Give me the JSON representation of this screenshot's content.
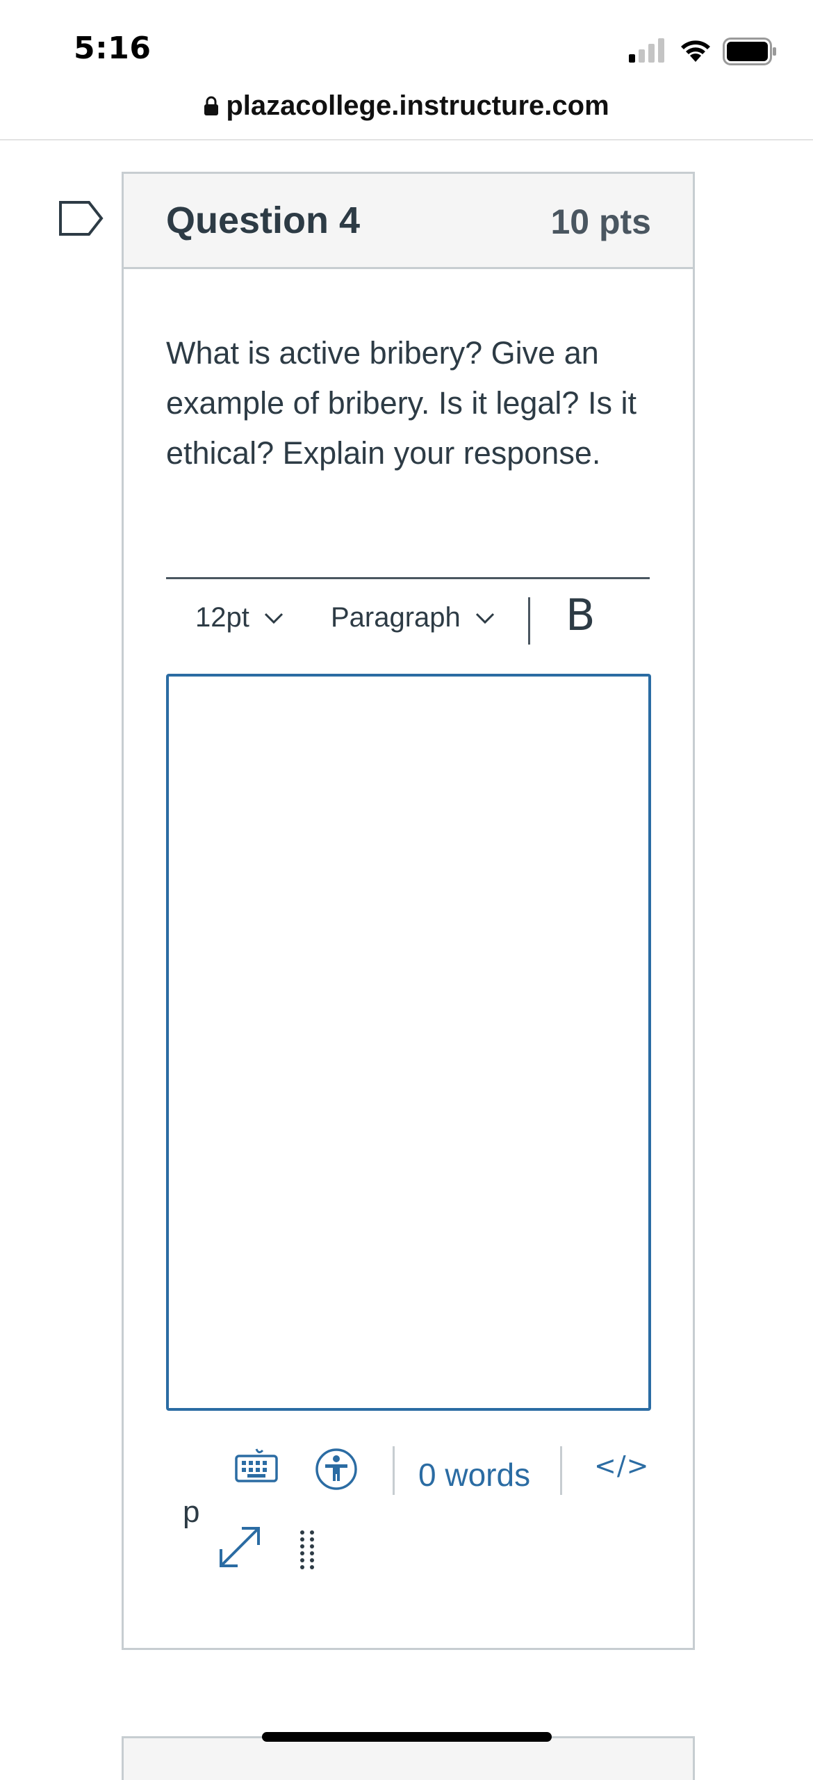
{
  "status_bar": {
    "time": "5:16"
  },
  "browser": {
    "url": "plazacollege.instructure.com"
  },
  "question": {
    "title": "Question 4",
    "points": "10 pts",
    "text": "What is active bribery? Give an example of bribery. Is it legal? Is it ethical? Explain your response."
  },
  "editor": {
    "font_size": "12pt",
    "block_format": "Paragraph",
    "bold_label": "B",
    "content": "",
    "path": "p",
    "word_count": "0 words",
    "html_toggle_label": "</>"
  },
  "colors": {
    "accent": "#2b6ca3",
    "text": "#2d3b45",
    "border": "#c7cdd1",
    "header_bg": "#f5f5f5"
  },
  "icons": {
    "status": [
      "signal-icon",
      "wifi-icon",
      "battery-icon"
    ],
    "url": "lock-icon",
    "question": "flag-icon",
    "editor_status": [
      "keyboard-icon",
      "accessibility-icon",
      "fullscreen-icon",
      "resize-icon"
    ]
  }
}
